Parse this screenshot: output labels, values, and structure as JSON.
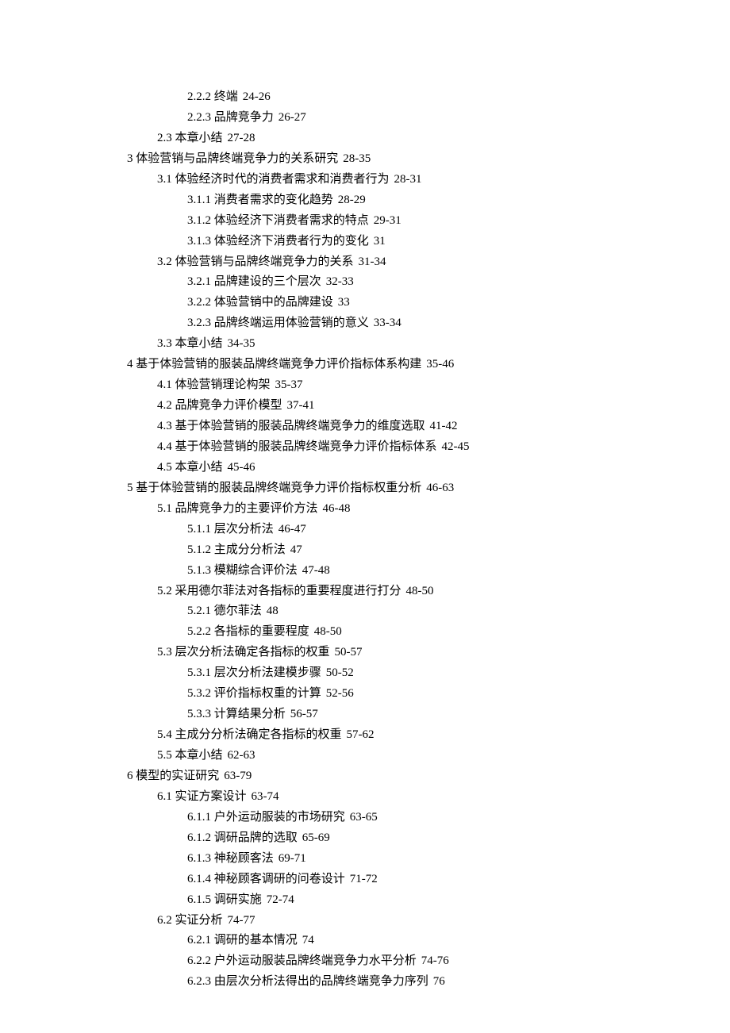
{
  "toc": [
    {
      "level": 2,
      "label": "2.2.2 终端",
      "pages": "24-26"
    },
    {
      "level": 2,
      "label": "2.2.3 品牌竞争力",
      "pages": "26-27"
    },
    {
      "level": 1,
      "label": "2.3 本章小结",
      "pages": "27-28"
    },
    {
      "level": 0,
      "label": "3 体验营销与品牌终端竞争力的关系研究",
      "pages": "28-35"
    },
    {
      "level": 1,
      "label": "3.1 体验经济时代的消费者需求和消费者行为",
      "pages": "28-31"
    },
    {
      "level": 2,
      "label": "3.1.1 消费者需求的变化趋势",
      "pages": "28-29"
    },
    {
      "level": 2,
      "label": "3.1.2 体验经济下消费者需求的特点",
      "pages": "29-31"
    },
    {
      "level": 2,
      "label": "3.1.3 体验经济下消费者行为的变化",
      "pages": "31"
    },
    {
      "level": 1,
      "label": "3.2 体验营销与品牌终端竞争力的关系",
      "pages": "31-34"
    },
    {
      "level": 2,
      "label": "3.2.1 品牌建设的三个层次",
      "pages": "32-33"
    },
    {
      "level": 2,
      "label": "3.2.2 体验营销中的品牌建设",
      "pages": "33"
    },
    {
      "level": 2,
      "label": "3.2.3 品牌终端运用体验营销的意义",
      "pages": "33-34"
    },
    {
      "level": 1,
      "label": "3.3 本章小结",
      "pages": "34-35"
    },
    {
      "level": 0,
      "label": "4 基于体验营销的服装品牌终端竞争力评价指标体系构建",
      "pages": "35-46"
    },
    {
      "level": 1,
      "label": "4.1 体验营销理论构架",
      "pages": "35-37"
    },
    {
      "level": 1,
      "label": "4.2 品牌竞争力评价模型",
      "pages": "37-41"
    },
    {
      "level": 1,
      "label": "4.3 基于体验营销的服装品牌终端竞争力的维度选取",
      "pages": "41-42"
    },
    {
      "level": 1,
      "label": "4.4 基于体验营销的服装品牌终端竞争力评价指标体系",
      "pages": "42-45"
    },
    {
      "level": 1,
      "label": "4.5 本章小结",
      "pages": "45-46"
    },
    {
      "level": 0,
      "label": "5 基于体验营销的服装品牌终端竞争力评价指标权重分析",
      "pages": "46-63"
    },
    {
      "level": 1,
      "label": "5.1 品牌竞争力的主要评价方法",
      "pages": "46-48"
    },
    {
      "level": 2,
      "label": "5.1.1 层次分析法",
      "pages": "46-47"
    },
    {
      "level": 2,
      "label": "5.1.2 主成分分析法",
      "pages": "47"
    },
    {
      "level": 2,
      "label": "5.1.3 模糊综合评价法",
      "pages": "47-48"
    },
    {
      "level": 1,
      "label": "5.2 采用德尔菲法对各指标的重要程度进行打分",
      "pages": "48-50"
    },
    {
      "level": 2,
      "label": "5.2.1 德尔菲法",
      "pages": "48"
    },
    {
      "level": 2,
      "label": "5.2.2 各指标的重要程度",
      "pages": "48-50"
    },
    {
      "level": 1,
      "label": "5.3 层次分析法确定各指标的权重",
      "pages": "50-57"
    },
    {
      "level": 2,
      "label": "5.3.1 层次分析法建模步骤",
      "pages": "50-52"
    },
    {
      "level": 2,
      "label": "5.3.2 评价指标权重的计算",
      "pages": "52-56"
    },
    {
      "level": 2,
      "label": "5.3.3 计算结果分析",
      "pages": "56-57"
    },
    {
      "level": 1,
      "label": "5.4 主成分分析法确定各指标的权重",
      "pages": "57-62"
    },
    {
      "level": 1,
      "label": "5.5 本章小结",
      "pages": "62-63"
    },
    {
      "level": 0,
      "label": "6 模型的实证研究",
      "pages": "63-79"
    },
    {
      "level": 1,
      "label": "6.1 实证方案设计",
      "pages": "63-74"
    },
    {
      "level": 2,
      "label": "6.1.1 户外运动服装的市场研究",
      "pages": "63-65"
    },
    {
      "level": 2,
      "label": "6.1.2 调研品牌的选取",
      "pages": "65-69"
    },
    {
      "level": 2,
      "label": "6.1.3 神秘顾客法",
      "pages": "69-71"
    },
    {
      "level": 2,
      "label": "6.1.4 神秘顾客调研的问卷设计",
      "pages": "71-72"
    },
    {
      "level": 2,
      "label": "6.1.5 调研实施",
      "pages": "72-74"
    },
    {
      "level": 1,
      "label": "6.2 实证分析",
      "pages": "74-77"
    },
    {
      "level": 2,
      "label": "6.2.1 调研的基本情况",
      "pages": "74"
    },
    {
      "level": 2,
      "label": "6.2.2 户外运动服装品牌终端竞争力水平分析",
      "pages": "74-76"
    },
    {
      "level": 2,
      "label": "6.2.3 由层次分析法得出的品牌终端竞争力序列",
      "pages": "76"
    }
  ]
}
